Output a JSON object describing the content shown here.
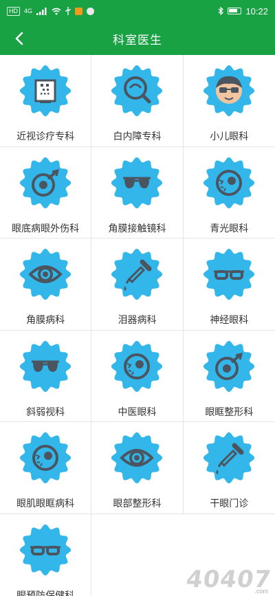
{
  "status_bar": {
    "network_chip": "HD",
    "network_gen": "4G",
    "signal_icon": "signal-bars-icon",
    "wifi_icon": "wifi-icon",
    "usb_icon": "usb-icon",
    "bluetooth_icon": "bluetooth-icon",
    "battery_icon": "battery-icon",
    "time": "10:22"
  },
  "header": {
    "title": "科室医生",
    "back_icon": "chevron-left-icon",
    "color": "#18a243"
  },
  "badge_color": "#33b7ea",
  "departments": [
    {
      "label": "近视诊疗专科",
      "icon": "eye-chart-icon"
    },
    {
      "label": "白内障专科",
      "icon": "eye-magnifier-icon"
    },
    {
      "label": "小儿眼科",
      "icon": "child-glasses-icon"
    },
    {
      "label": "眼底病眼外伤科",
      "icon": "injured-eye-icon"
    },
    {
      "label": "角膜接触镜科",
      "icon": "sunglasses-icon"
    },
    {
      "label": "青光眼科",
      "icon": "eyeball-icon"
    },
    {
      "label": "角膜病科",
      "icon": "eye-icon"
    },
    {
      "label": "泪器病科",
      "icon": "dropper-icon"
    },
    {
      "label": "神经眼科",
      "icon": "glasses-icon"
    },
    {
      "label": "斜弱视科",
      "icon": "sunglasses-icon"
    },
    {
      "label": "中医眼科",
      "icon": "eyeball-icon"
    },
    {
      "label": "眼眶整形科",
      "icon": "injured-eye-icon"
    },
    {
      "label": "眼肌眼眶病科",
      "icon": "eyeball-icon"
    },
    {
      "label": "眼部整形科",
      "icon": "eye-icon"
    },
    {
      "label": "干眼门诊",
      "icon": "dropper-icon"
    },
    {
      "label": "眼预防保健科",
      "icon": "glasses-icon"
    }
  ],
  "watermark": {
    "main": "40407",
    "sub": ".com"
  }
}
